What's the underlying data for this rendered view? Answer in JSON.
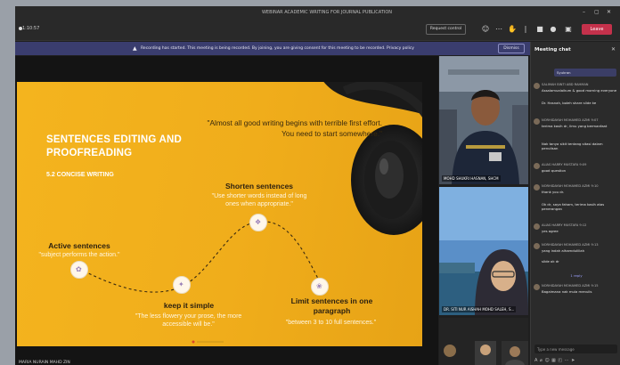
{
  "window": {
    "title": "WEBINAR ACADEMIC WRITING FOR JOURNAL PUBLICATION"
  },
  "toolbar": {
    "timer": "1:10:57",
    "record_label": "Request control",
    "leave_label": "Leave"
  },
  "banner": {
    "message": "Recording has started. This meeting is being recorded. By joining, you are giving consent for this meeting to be recorded. Privacy policy",
    "dismiss_label": "Dismiss"
  },
  "slide": {
    "title": "SENTENCES EDITING AND PROOFREADING",
    "subtitle": "5.2 CONCISE WRITING",
    "quote": "\"Almost all good writing begins with terrible first effort. You need to start somewhere.\"",
    "nodes": [
      {
        "title": "Active sentences",
        "desc": "\"subject performs the action.\""
      },
      {
        "title": "keep it simple",
        "desc": "\"The less flowery your prose, the more accessible will be.\""
      },
      {
        "title": "Shorten sentences",
        "desc": "\"Use shorter words instead of long ones when appropriate.\""
      },
      {
        "title": "Limit sentences in one paragraph",
        "desc": "\"between 3 to 10 full sentences.\""
      }
    ]
  },
  "stage": {
    "presenter_tag": "MARIA NURAIN MAHD ZIN"
  },
  "videos": [
    {
      "name": "MOHD SHUKRI HASNAN, SHCM"
    },
    {
      "name": "DR. SITI NUR AISHAH MOHD SALEH, S..."
    }
  ],
  "chat": {
    "header": "Meeting chat",
    "compose_placeholder": "Type a new message",
    "messages": [
      {
        "kind": "sent",
        "text": "Syukran"
      },
      {
        "kind": "recv",
        "name": "SALIMAH BINTI ABD RAHMAN",
        "text": "Assalamualaikum & good morning everyone"
      },
      {
        "kind": "recv",
        "name": "",
        "text": "Dr. Hasnah, boleh share slide ke"
      },
      {
        "kind": "recv",
        "name": "NORHIDAYAH MOHAMED AZMI 9:07",
        "text": "terima kasih dr, ilmu yang bermanfaat"
      },
      {
        "kind": "recv",
        "name": "",
        "text": "Nak tanya sikit tentang sitasi dalam penulisan"
      },
      {
        "kind": "recv",
        "name": "ALIAS HARRY MUSTAFA 9:09",
        "text": "good question"
      },
      {
        "kind": "recv",
        "name": "NORHIDAYAH MOHAMED AZMI 9:10",
        "text": "thank you dr."
      },
      {
        "kind": "recv",
        "name": "",
        "text": "Ok dr, saya faham, terima kasih atas penerangan"
      },
      {
        "kind": "recv",
        "name": "ALIAS HARRY MUSTAFA 9:12",
        "text": "yes agree"
      },
      {
        "kind": "recv",
        "name": "NORHIDAYAH MOHAMED AZMI 9:13",
        "text": "yang indah alhamdulillah"
      },
      {
        "kind": "recv",
        "name": "",
        "text": "slide ok dr"
      },
      {
        "kind": "sent",
        "text": "1 reply"
      },
      {
        "kind": "recv",
        "name": "NORHIDAYAH MOHAMED AZMI 9:15",
        "text": "Bagaimana nak mula menulis"
      }
    ]
  },
  "colors": {
    "slide_yellow": "#f2b21e",
    "leave_red": "#c4314b",
    "banner_purple": "#3a3d6e"
  }
}
